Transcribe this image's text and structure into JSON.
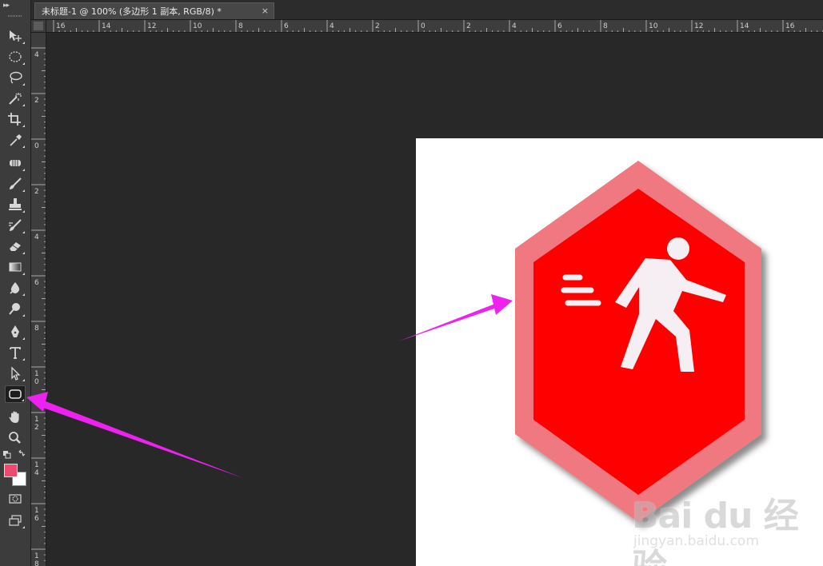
{
  "document_tab": {
    "title": "未标题-1 @ 100% (多边形 1 副本, RGB/8) *",
    "close_label": "×"
  },
  "toolbar": {
    "tools": [
      {
        "name": "move-tool",
        "icon": "move-icon"
      },
      {
        "name": "elliptical-marquee-tool",
        "icon": "elliptical-marquee-icon"
      },
      {
        "name": "lasso-tool",
        "icon": "lasso-icon"
      },
      {
        "name": "magic-wand-tool",
        "icon": "magic-wand-icon"
      },
      {
        "name": "crop-tool",
        "icon": "crop-icon"
      },
      {
        "name": "eyedropper-tool",
        "icon": "eyedropper-icon"
      },
      {
        "name": "healing-brush-tool",
        "icon": "healing-brush-icon"
      },
      {
        "name": "brush-tool",
        "icon": "brush-icon"
      },
      {
        "name": "clone-stamp-tool",
        "icon": "clone-stamp-icon"
      },
      {
        "name": "history-brush-tool",
        "icon": "history-brush-icon"
      },
      {
        "name": "eraser-tool",
        "icon": "eraser-icon"
      },
      {
        "name": "gradient-tool",
        "icon": "gradient-icon"
      },
      {
        "name": "blur-tool",
        "icon": "blur-icon"
      },
      {
        "name": "dodge-tool",
        "icon": "dodge-icon"
      },
      {
        "name": "pen-tool",
        "icon": "pen-icon"
      },
      {
        "name": "type-tool",
        "icon": "type-icon",
        "glyph": "T"
      },
      {
        "name": "path-selection-tool",
        "icon": "path-selection-icon"
      },
      {
        "name": "rounded-rectangle-tool",
        "icon": "rounded-rectangle-icon",
        "active": true
      },
      {
        "name": "hand-tool",
        "icon": "hand-icon"
      },
      {
        "name": "zoom-tool",
        "icon": "zoom-icon"
      }
    ],
    "foreground_color": "#ee4a6f",
    "background_color": "#ffffff"
  },
  "rulers": {
    "horizontal_labels": [
      "16",
      "14",
      "12",
      "10",
      "8",
      "6",
      "4",
      "2",
      "0",
      "2",
      "4",
      "6",
      "8",
      "10",
      "12",
      "14",
      "16"
    ],
    "vertical_labels": [
      "4",
      "2",
      "0",
      "2",
      "4",
      "6",
      "8",
      "1 0",
      "1 2",
      "1 4",
      "1 6",
      "1 8"
    ]
  },
  "canvas": {
    "background": "#ffffff",
    "badge": {
      "outer_color": "#f07880",
      "inner_color": "#ff0000",
      "figure_color": "#f5eef2",
      "icon": "walking-person-icon"
    }
  },
  "watermark": {
    "brand": "Bai  du 经验",
    "url": "jingyan.baidu.com"
  },
  "annotations": {
    "arrow_color": "#ee22ee"
  }
}
